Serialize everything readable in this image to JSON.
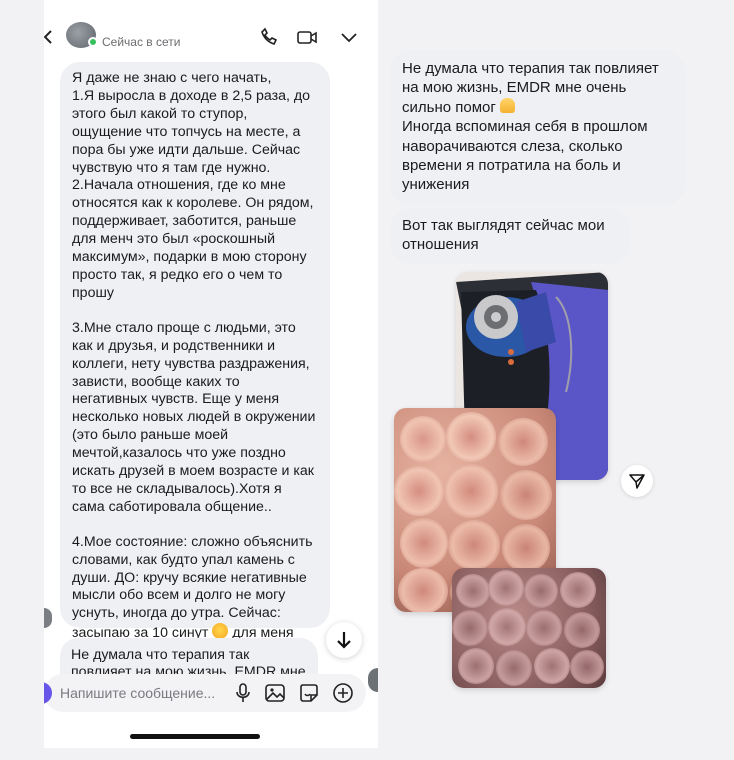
{
  "header": {
    "status": "Сейчас в сети"
  },
  "left_message": {
    "intro": "Я даже не знаю с чего начать,",
    "point1": "1.Я выросла в доходе в 2,5 раза, до этого был какой то ступор, ощущение что топчусь на месте, а пора бы уже идти дальше. Сейчас чувствую что я там где нужно.",
    "point2": "2.Начала отношения, где ко мне относятся как к королеве. Он рядом, поддерживает, заботится, раньше для менч это был «роскошный максимум», подарки в мою сторону просто так, я редко его о чем то прошу",
    "point3": "3.Мне стало проще с людьми, это как и друзья, и родственники и коллеги, нету чувства раздражения, зависти, вообще каких то негативных чувств. Еще у меня несколько новых людей в окружении (это было раньше моей мечтой,казалось что уже поздно искать друзей в моем возрасте и как то все не складывалось).Хотя я сама саботировала общение..",
    "point4_part1": "4.Мое состояние: сложно объяснить словами, как будто упал камень с души. ДО: кручу всякие негативные мысли обо всем и долго не могу уснуть, иногда до утра. Сейчас: засыпаю за 10 синут",
    "point4_part2": "для меня это шок."
  },
  "left_message_2": {
    "text": "Не думала что терапия так повлияет на мою жизнь. EMDR мне очень"
  },
  "composer": {
    "placeholder": "Напишите сообщение..."
  },
  "right_messages": {
    "msg1_part1": "Не думала что терапия так повлияет на мою жизнь, EMDR мне очень сильно помог",
    "msg1_part2": "Иногда вспоминая себя в прошлом наворачиваются слеза, сколько времени я потратила на боль и унижения",
    "msg2": "Вот так выглядят сейчас мои отношения"
  },
  "icons": {
    "back": "chevron-left-icon",
    "call": "phone-icon",
    "video": "video-icon",
    "more": "chevron-down-icon",
    "scroll": "arrow-down-icon",
    "mic": "mic-icon",
    "gallery": "image-icon",
    "sticker": "sticker-icon",
    "plus": "plus-icon",
    "share": "send-icon"
  },
  "colors": {
    "bubble": "#eff0f3",
    "online": "#36c05e",
    "accent": "#6655e8"
  }
}
